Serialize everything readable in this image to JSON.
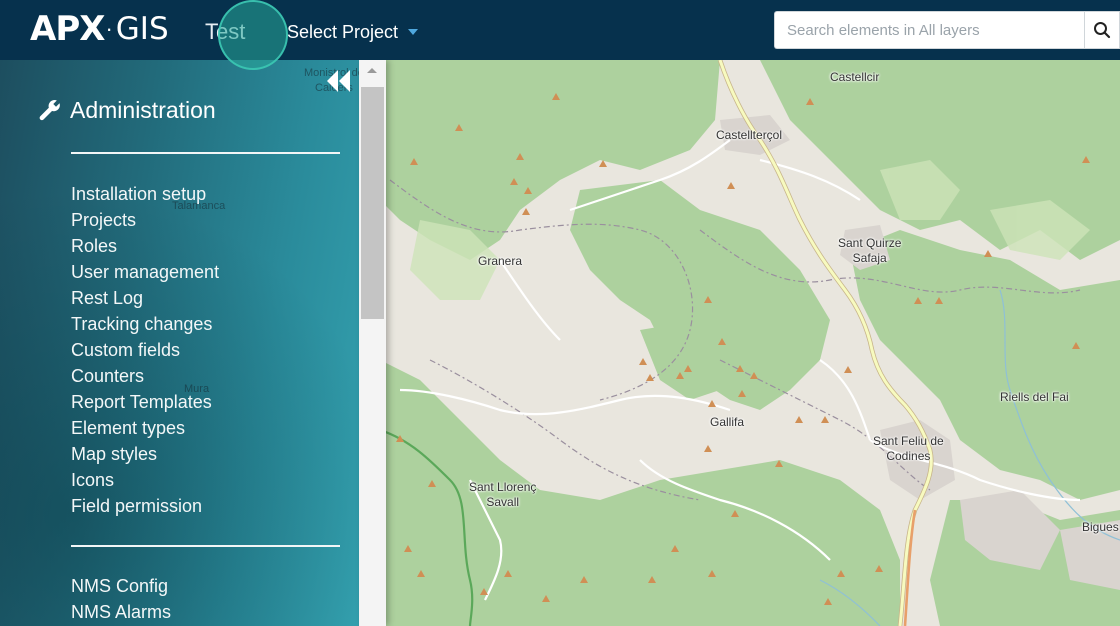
{
  "header": {
    "logo_primary": "APX",
    "logo_separator": "·",
    "logo_secondary": "GIS",
    "project_name": "Test",
    "select_project_label": "Select Project",
    "search_placeholder": "Search elements in All layers"
  },
  "sidebar": {
    "title": "Administration",
    "menu_group_1": [
      "Installation setup",
      "Projects",
      "Roles",
      "User management",
      "Rest Log",
      "Tracking changes",
      "Custom fields",
      "Counters",
      "Report Templates",
      "Element types",
      "Map styles",
      "Icons",
      "Field permission"
    ],
    "menu_group_2": [
      "NMS Config",
      "NMS Alarms"
    ]
  },
  "map": {
    "places": [
      {
        "name": "Castellcir"
      },
      {
        "name": "Castellterçol"
      },
      {
        "name": "Granera"
      },
      {
        "name": "Sant Quirze\nSafaja"
      },
      {
        "name": "Gallifa"
      },
      {
        "name": "Riells del Fai"
      },
      {
        "name": "Sant Feliu de\nCodines"
      },
      {
        "name": "Sant Llorenç\nSavall"
      },
      {
        "name": "Bigues"
      },
      {
        "name": "Talamanca"
      },
      {
        "name": "Mura"
      },
      {
        "name": "Monistrol de\nCalders"
      }
    ]
  },
  "colors": {
    "topbar": "#06314d",
    "caret": "#4fa8de",
    "forest": "#add19e",
    "road_major": "#f7fabf",
    "road_minor": "#ffffff",
    "peak": "#d08f55",
    "water": "#aad3df"
  }
}
